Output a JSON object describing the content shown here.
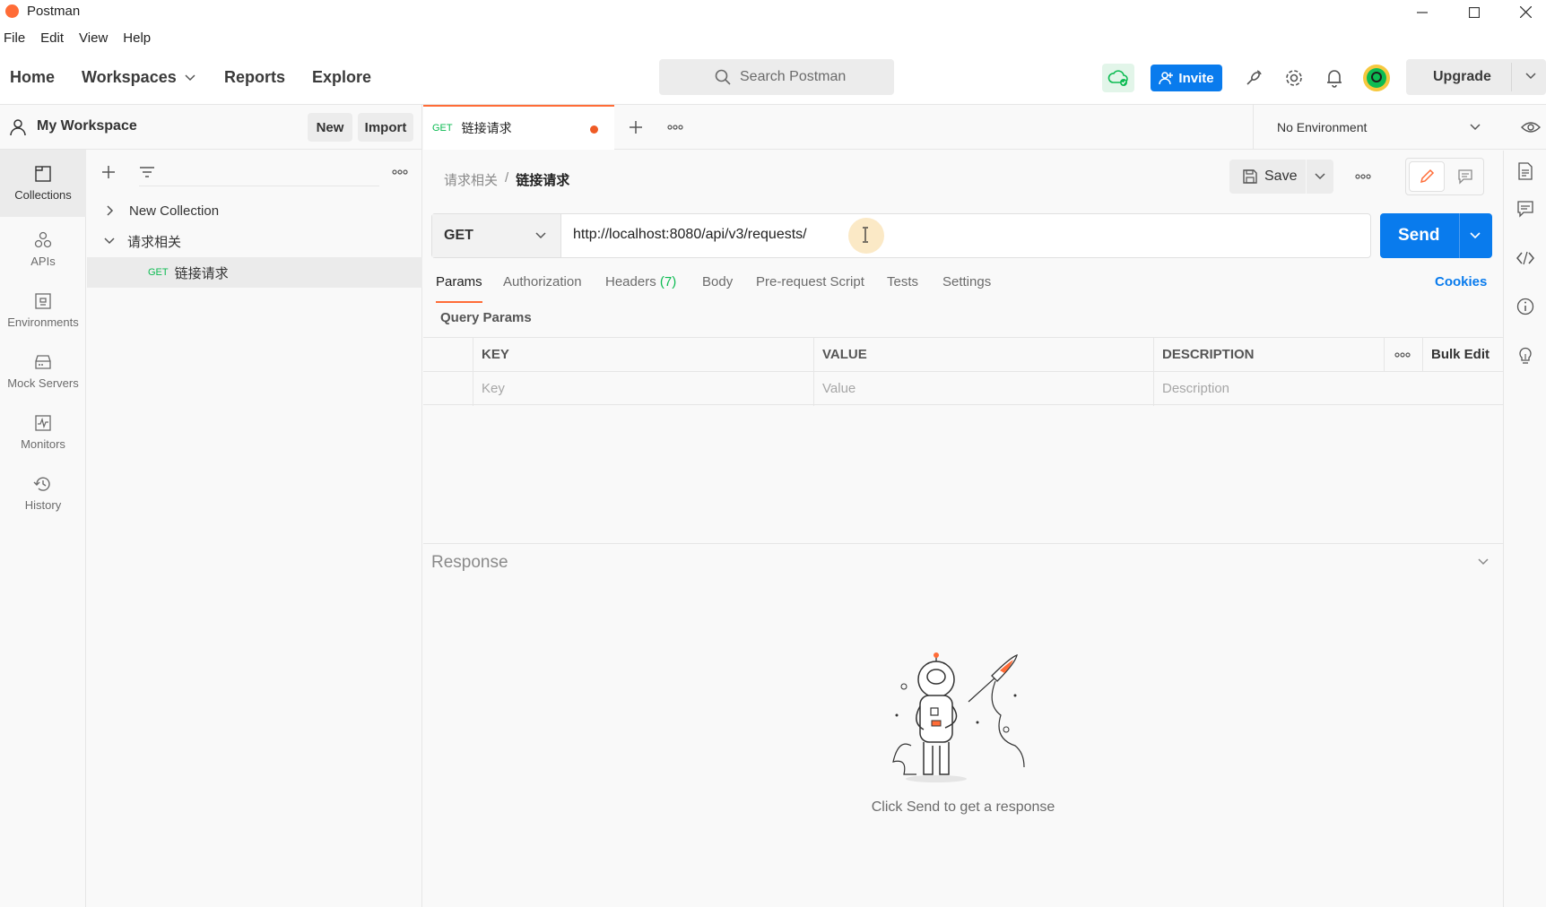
{
  "titlebar": {
    "title": "Postman"
  },
  "menu": [
    "File",
    "Edit",
    "View",
    "Help"
  ],
  "nav": {
    "home": "Home",
    "workspaces": "Workspaces",
    "reports": "Reports",
    "explore": "Explore"
  },
  "search": {
    "placeholder": "Search Postman"
  },
  "header": {
    "invite": "Invite",
    "upgrade": "Upgrade"
  },
  "workspace": {
    "name": "My Workspace",
    "new_label": "New",
    "import_label": "Import"
  },
  "rail": [
    {
      "label": "Collections",
      "icon": "collections-icon"
    },
    {
      "label": "APIs",
      "icon": "apis-icon"
    },
    {
      "label": "Environments",
      "icon": "environments-icon"
    },
    {
      "label": "Mock Servers",
      "icon": "mock-servers-icon"
    },
    {
      "label": "Monitors",
      "icon": "monitors-icon"
    },
    {
      "label": "History",
      "icon": "history-icon"
    }
  ],
  "tree": {
    "new_collection": "New Collection",
    "folder": "请求相关",
    "request_method": "GET",
    "request_name": "链接请求"
  },
  "tab": {
    "method": "GET",
    "name": "链接请求"
  },
  "environment": {
    "selected": "No Environment"
  },
  "breadcrumb": {
    "parent": "请求相关",
    "separator": "/",
    "current": "链接请求"
  },
  "request": {
    "save_label": "Save",
    "method": "GET",
    "url": "http://localhost:8080/api/v3/requests/",
    "send_label": "Send"
  },
  "req_tabs": {
    "params": "Params",
    "authorization": "Authorization",
    "headers": "Headers",
    "headers_count": "(7)",
    "body": "Body",
    "prerequest": "Pre-request Script",
    "tests": "Tests",
    "settings": "Settings",
    "cookies": "Cookies"
  },
  "query_params": {
    "title": "Query Params",
    "columns": {
      "key": "KEY",
      "value": "VALUE",
      "description": "DESCRIPTION",
      "bulk_edit": "Bulk Edit"
    },
    "placeholders": {
      "key": "Key",
      "value": "Value",
      "description": "Description"
    }
  },
  "response": {
    "title": "Response",
    "empty_text": "Click Send to get a response"
  },
  "colors": {
    "accent": "#ff6c37",
    "primary": "#097bed",
    "get": "#0cbb52"
  }
}
